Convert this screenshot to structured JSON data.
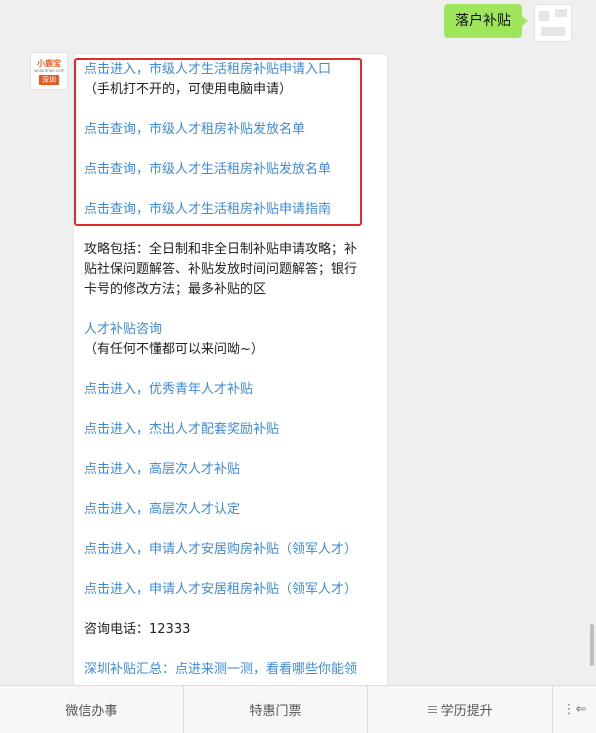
{
  "user_message": "落户补贴",
  "bot": {
    "avatar": {
      "brand_text": "小鹿宝",
      "site_text": "lunlunmoe.com",
      "city_text": "深圳"
    },
    "messages": [
      {
        "type": "link",
        "text": "点击进入，市级人才生活租房补贴申请入口"
      },
      {
        "type": "text",
        "text": "（手机打不开的，可使用电脑申请）"
      },
      {
        "type": "link",
        "text": "点击查询，市级人才租房补贴发放名单"
      },
      {
        "type": "link",
        "text": "点击查询，市级人才生活租房补贴发放名单"
      },
      {
        "type": "link",
        "text": "点击查询，市级人才生活租房补贴申请指南"
      },
      {
        "type": "text",
        "lines": [
          "攻略包括：全日制和非全日制补贴申请攻略；补",
          "贴社保问题解答、补贴发放时间问题解答；银行",
          "卡号的修改方法；最多补贴的区"
        ]
      },
      {
        "type": "link",
        "text": "人才补贴咨询"
      },
      {
        "type": "text",
        "text": "（有任何不懂都可以来问呦~）"
      },
      {
        "type": "link",
        "text": "点击进入，优秀青年人才补贴"
      },
      {
        "type": "link",
        "text": "点击进入，杰出人才配套奖励补贴"
      },
      {
        "type": "link",
        "text": "点击进入，高层次人才补贴"
      },
      {
        "type": "link",
        "text": "点击进入，高层次人才认定"
      },
      {
        "type": "link",
        "text": "点击进入，申请人才安居购房补贴（领军人才）"
      },
      {
        "type": "link",
        "text": "点击进入，申请人才安居租房补贴（领军人才）"
      },
      {
        "type": "text",
        "text": "咨询电话：12333"
      },
      {
        "type": "link",
        "text": "深圳补贴汇总：点进来测一测，看看哪些你能领"
      }
    ]
  },
  "bottom_menu": {
    "items": [
      "微信办事",
      "特惠门票",
      "学历提升"
    ],
    "keyboard_toggle": "⋮⇐"
  }
}
